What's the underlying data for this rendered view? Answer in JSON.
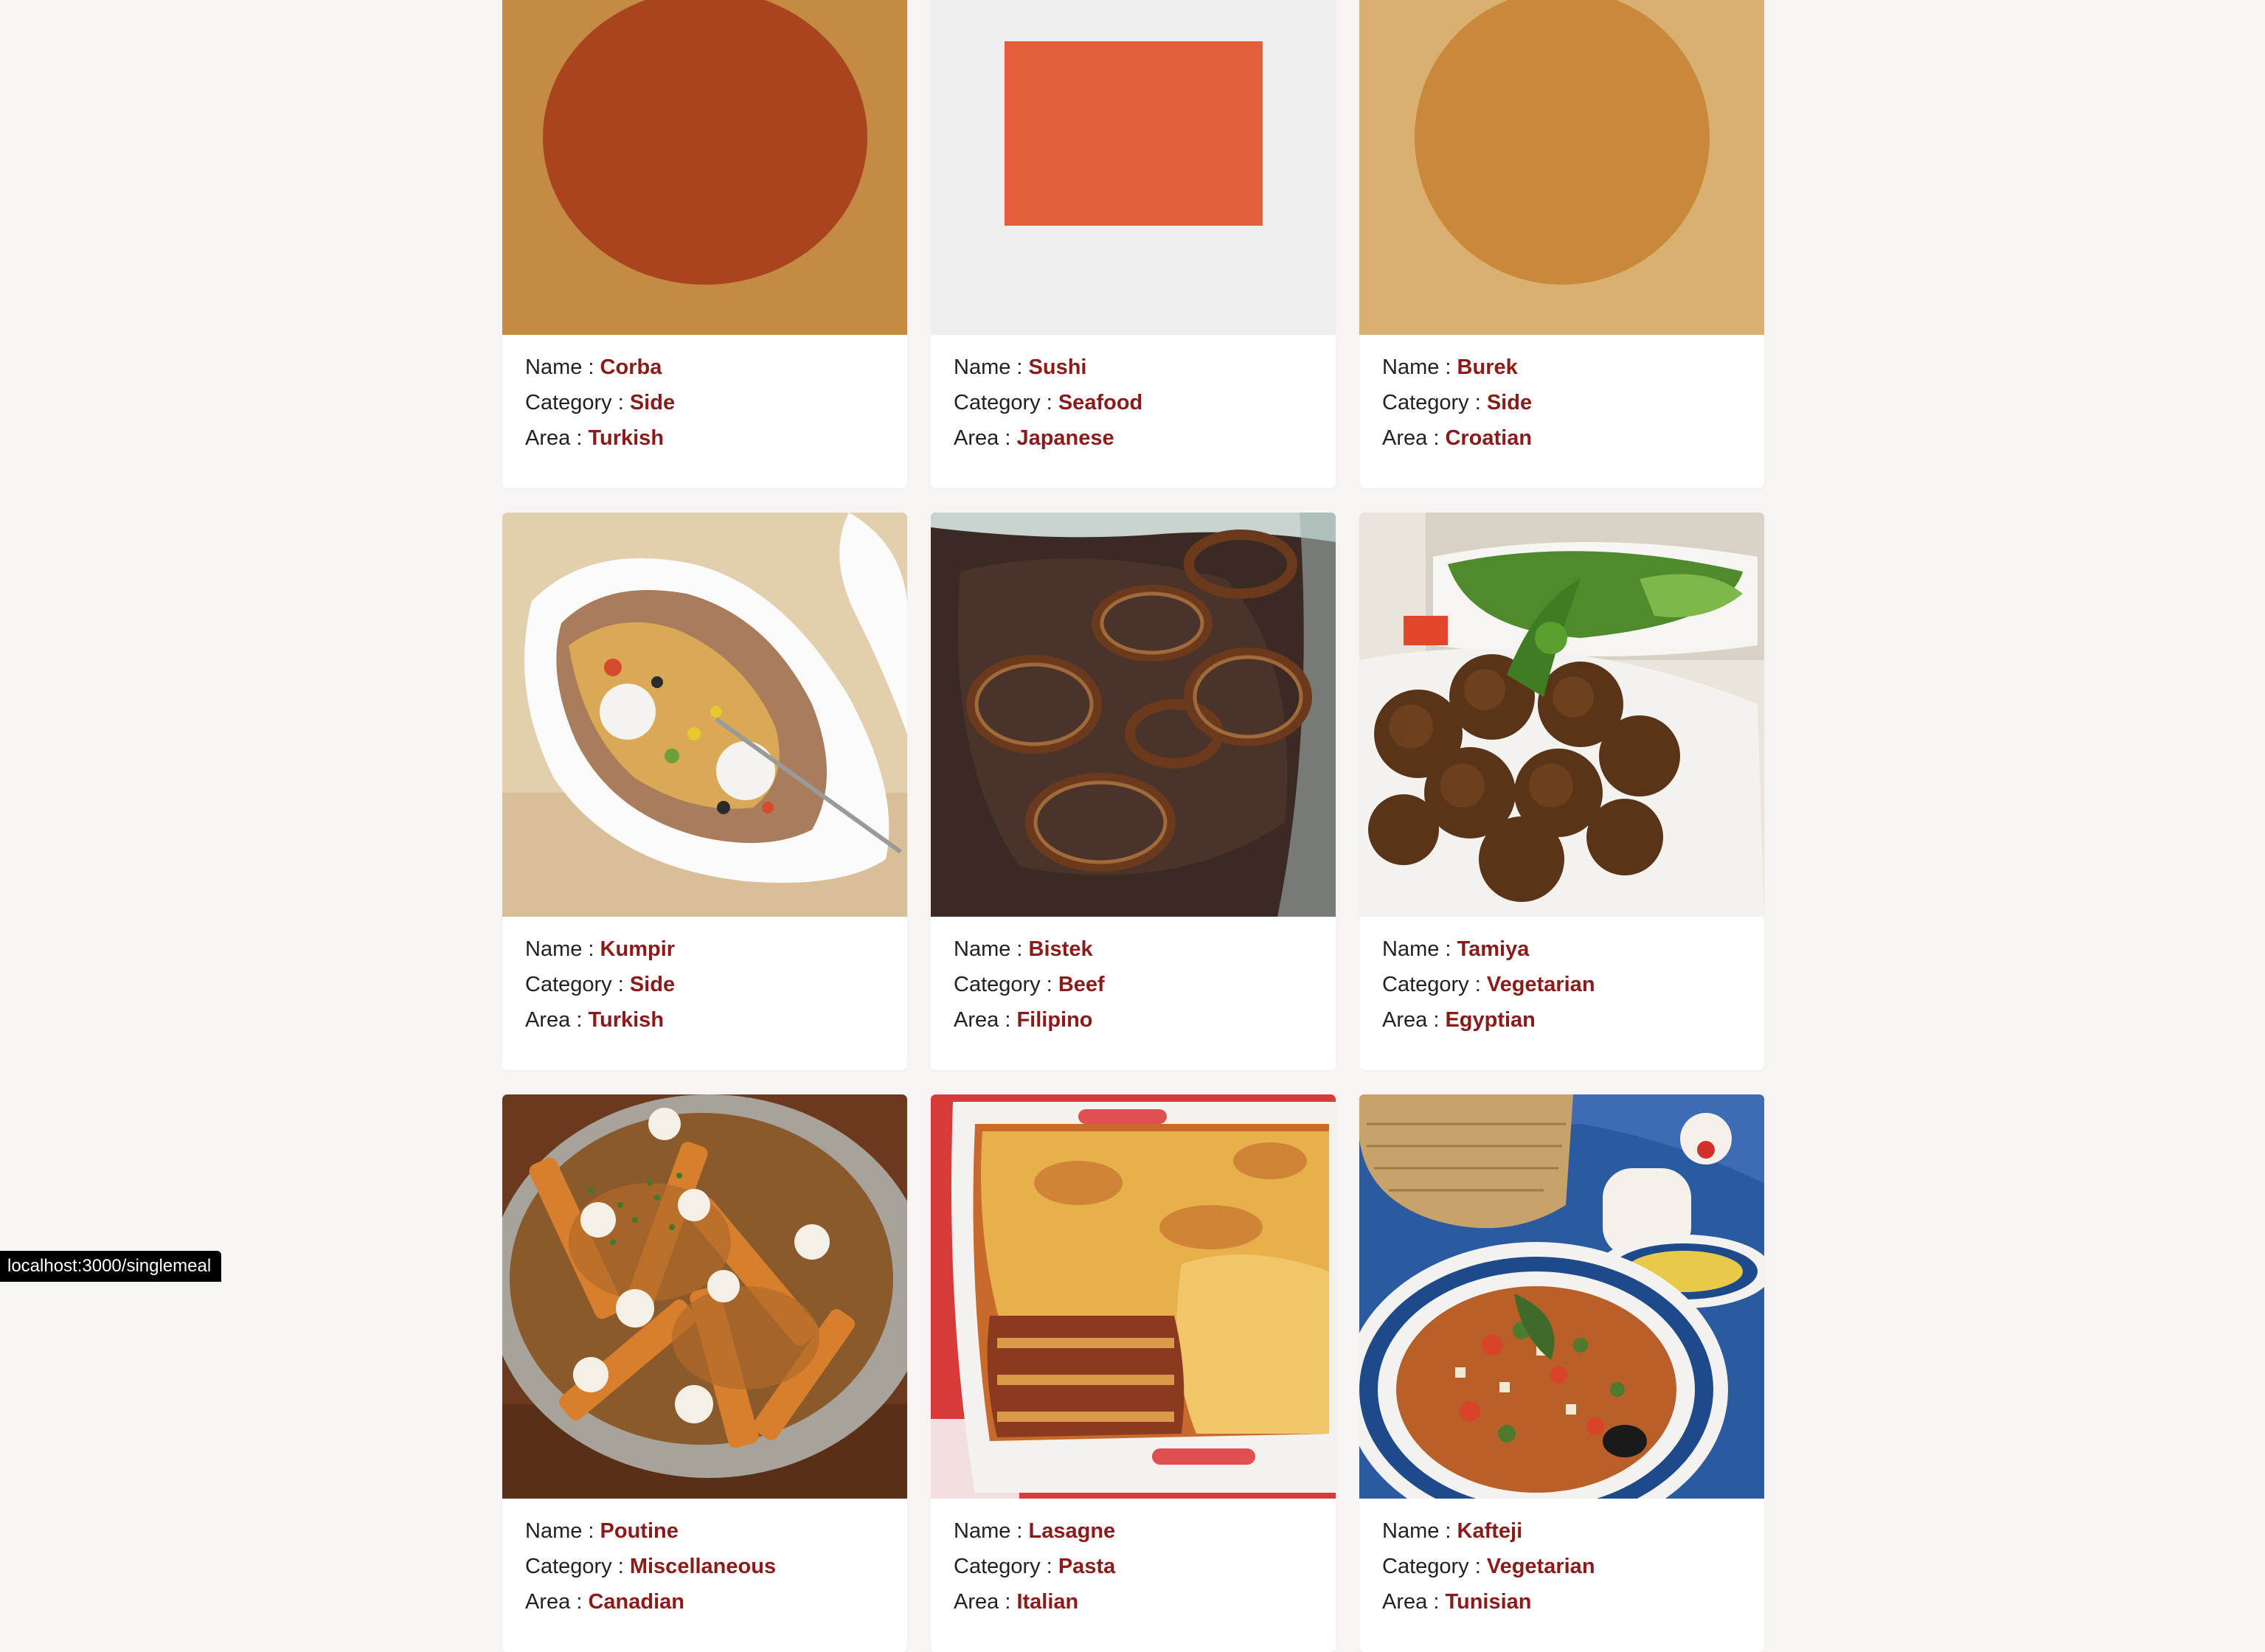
{
  "labels": {
    "name": "Name : ",
    "category": "Category : ",
    "area": "Area : "
  },
  "meals": [
    {
      "name": "Corba",
      "category": "Side",
      "area": "Turkish",
      "image": "corba-photo"
    },
    {
      "name": "Sushi",
      "category": "Seafood",
      "area": "Japanese",
      "image": "sushi-photo"
    },
    {
      "name": "Burek",
      "category": "Side",
      "area": "Croatian",
      "image": "burek-photo"
    },
    {
      "name": "Kumpir",
      "category": "Side",
      "area": "Turkish",
      "image": "kumpir-photo"
    },
    {
      "name": "Bistek",
      "category": "Beef",
      "area": "Filipino",
      "image": "bistek-photo"
    },
    {
      "name": "Tamiya",
      "category": "Vegetarian",
      "area": "Egyptian",
      "image": "tamiya-photo"
    },
    {
      "name": "Poutine",
      "category": "Miscellaneous",
      "area": "Canadian",
      "image": "poutine-photo"
    },
    {
      "name": "Lasagne",
      "category": "Pasta",
      "area": "Italian",
      "image": "lasagne-photo"
    },
    {
      "name": "Kafteji",
      "category": "Vegetarian",
      "area": "Tunisian",
      "image": "kafteji-photo"
    }
  ],
  "status_bar": {
    "url": "localhost:3000/singlemeal"
  },
  "colors": {
    "accent": "#8b1a1a",
    "background": "#f8f4f4",
    "card": "#ffffff"
  }
}
